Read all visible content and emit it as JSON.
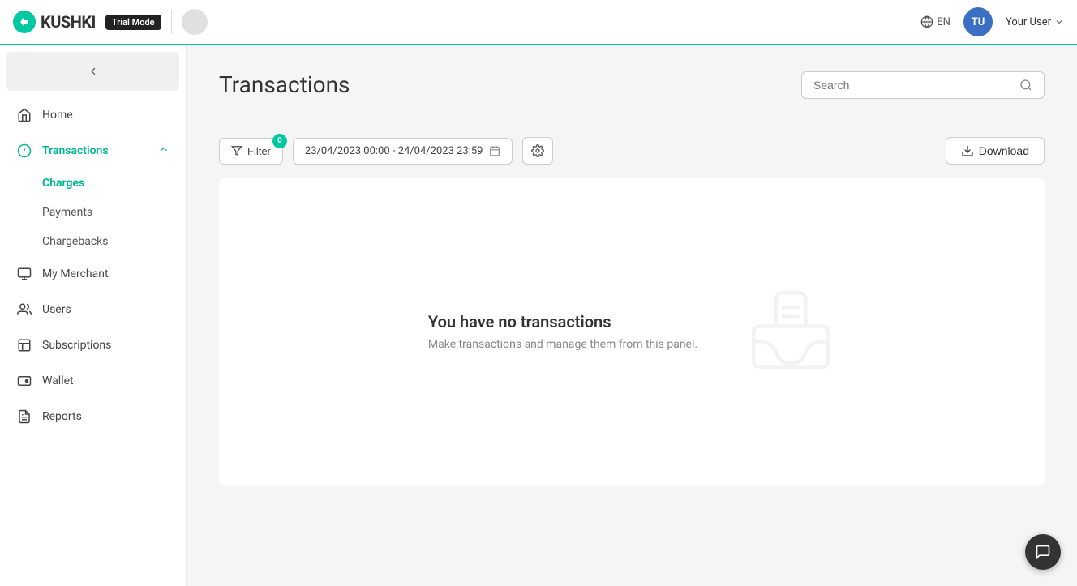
{
  "header": {
    "logo_text": "KUSHKI",
    "trial_badge": "Trial Mode",
    "lang": "EN",
    "user_initials": "TU",
    "user_name": "Your User"
  },
  "sidebar": {
    "collapse_label": "Collapse",
    "items": [
      {
        "id": "home",
        "label": "Home",
        "icon": "home-icon",
        "active": false
      },
      {
        "id": "transactions",
        "label": "Transactions",
        "icon": "transactions-icon",
        "active": true,
        "expanded": true
      },
      {
        "id": "my-merchant",
        "label": "My Merchant",
        "icon": "merchant-icon",
        "active": false
      },
      {
        "id": "users",
        "label": "Users",
        "icon": "users-icon",
        "active": false
      },
      {
        "id": "subscriptions",
        "label": "Subscriptions",
        "icon": "subscriptions-icon",
        "active": false
      },
      {
        "id": "wallet",
        "label": "Wallet",
        "icon": "wallet-icon",
        "active": false
      },
      {
        "id": "reports",
        "label": "Reports",
        "icon": "reports-icon",
        "active": false
      }
    ],
    "transactions_sub": [
      {
        "id": "charges",
        "label": "Charges",
        "active": true
      },
      {
        "id": "payments",
        "label": "Payments",
        "active": false
      },
      {
        "id": "chargebacks",
        "label": "Chargebacks",
        "active": false
      }
    ]
  },
  "page": {
    "title": "Transactions",
    "search_placeholder": "Search",
    "filter_label": "Filter",
    "filter_count": "0",
    "date_range": "23/04/2023 00:00 - 24/04/2023 23:59",
    "download_label": "Download",
    "empty_heading": "You have no transactions",
    "empty_subtext": "Make transactions and manage them from this panel."
  },
  "chat": {
    "icon": "chat-icon"
  }
}
